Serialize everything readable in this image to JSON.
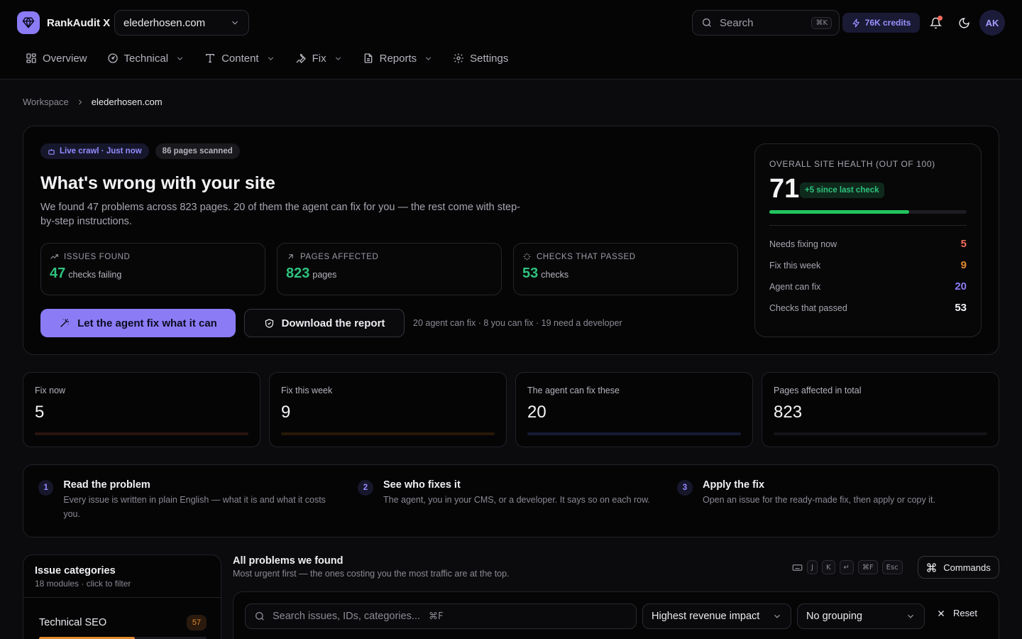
{
  "app": {
    "name": "RankAudit X",
    "site": "elederhosen.com",
    "search_placeholder": "Search",
    "search_shortcut": "⌘K",
    "credits": "76K credits",
    "avatar_initials": "AK"
  },
  "nav": [
    {
      "label": "Overview",
      "icon": "grid-icon"
    },
    {
      "label": "Technical",
      "icon": "gauge-icon"
    },
    {
      "label": "Content",
      "icon": "type-icon"
    },
    {
      "label": "Fix",
      "icon": "wrench-icon"
    },
    {
      "label": "Reports",
      "icon": "document-icon"
    },
    {
      "label": "Settings",
      "icon": "gear-icon"
    }
  ],
  "breadcrumb": {
    "root": "Workspace",
    "current": "elederhosen.com"
  },
  "hero": {
    "live_pill": "Live crawl · Just now",
    "pages_pill": "86 pages scanned",
    "title": "What's wrong with your site",
    "description": "We found 47 problems across 823 pages. 20 of them the agent can fix for you — the rest come with step-by-step instructions.",
    "metrics": [
      {
        "label": "ISSUES FOUND",
        "value": "47",
        "unit": "checks failing"
      },
      {
        "label": "PAGES AFFECTED",
        "value": "823",
        "unit": "pages"
      },
      {
        "label": "CHECKS THAT PASSED",
        "value": "53",
        "unit": "checks"
      }
    ],
    "primary_button": "Let the agent fix what it can",
    "secondary_button": "Download the report",
    "note": "20 agent can fix · 8 you can fix · 19 need a developer"
  },
  "health": {
    "label": "OVERALL SITE HEALTH (OUT OF 100)",
    "score": "71",
    "score_value": 71,
    "delta": "+5 since last check",
    "rows": [
      {
        "label": "Needs fixing now",
        "value": "5",
        "color": "#f26b5b"
      },
      {
        "label": "Fix this week",
        "value": "9",
        "color": "#e38a2b"
      },
      {
        "label": "Agent can fix",
        "value": "20",
        "color": "#8b7cf6"
      },
      {
        "label": "Checks that passed",
        "value": "53",
        "color": "#f4f4f7"
      }
    ]
  },
  "stats": [
    {
      "label": "Fix now",
      "value": "5",
      "bar_color": "#2a140f"
    },
    {
      "label": "Fix this week",
      "value": "9",
      "bar_color": "#281808"
    },
    {
      "label": "The agent can fix these",
      "value": "20",
      "bar_color": "#161a34"
    },
    {
      "label": "Pages affected in total",
      "value": "823",
      "bar_color": "#141418"
    }
  ],
  "steps": [
    {
      "num": "1",
      "title": "Read the problem",
      "desc": "Every issue is written in plain English — what it is and what it costs you."
    },
    {
      "num": "2",
      "title": "See who fixes it",
      "desc": "The agent, you in your CMS, or a developer. It says so on each row."
    },
    {
      "num": "3",
      "title": "Apply the fix",
      "desc": "Open an issue for the ready-made fix, then apply or copy it."
    }
  ],
  "categories": {
    "title": "Issue categories",
    "subtitle": "18 modules · click to filter",
    "items": [
      {
        "name": "Technical SEO",
        "count": "57",
        "fill_fraction": 0.57
      }
    ]
  },
  "problems": {
    "title": "All problems we found",
    "subtitle": "Most urgent first — the ones costing you the most traffic are at the top.",
    "shortcuts": [
      "J",
      "K",
      "↵",
      "⌘F",
      "Esc"
    ],
    "commands_label": "Commands",
    "search_placeholder": "Search issues, IDs, categories...",
    "search_hint": "⌘F",
    "sort_value": "Highest revenue impact",
    "group_value": "No grouping",
    "reset_label": "Reset"
  },
  "colors": {
    "accent": "#8b7cf6",
    "success": "#2ec27e",
    "danger": "#f26b5b",
    "warning": "#e38a2b",
    "background": "#0b0b0d"
  }
}
